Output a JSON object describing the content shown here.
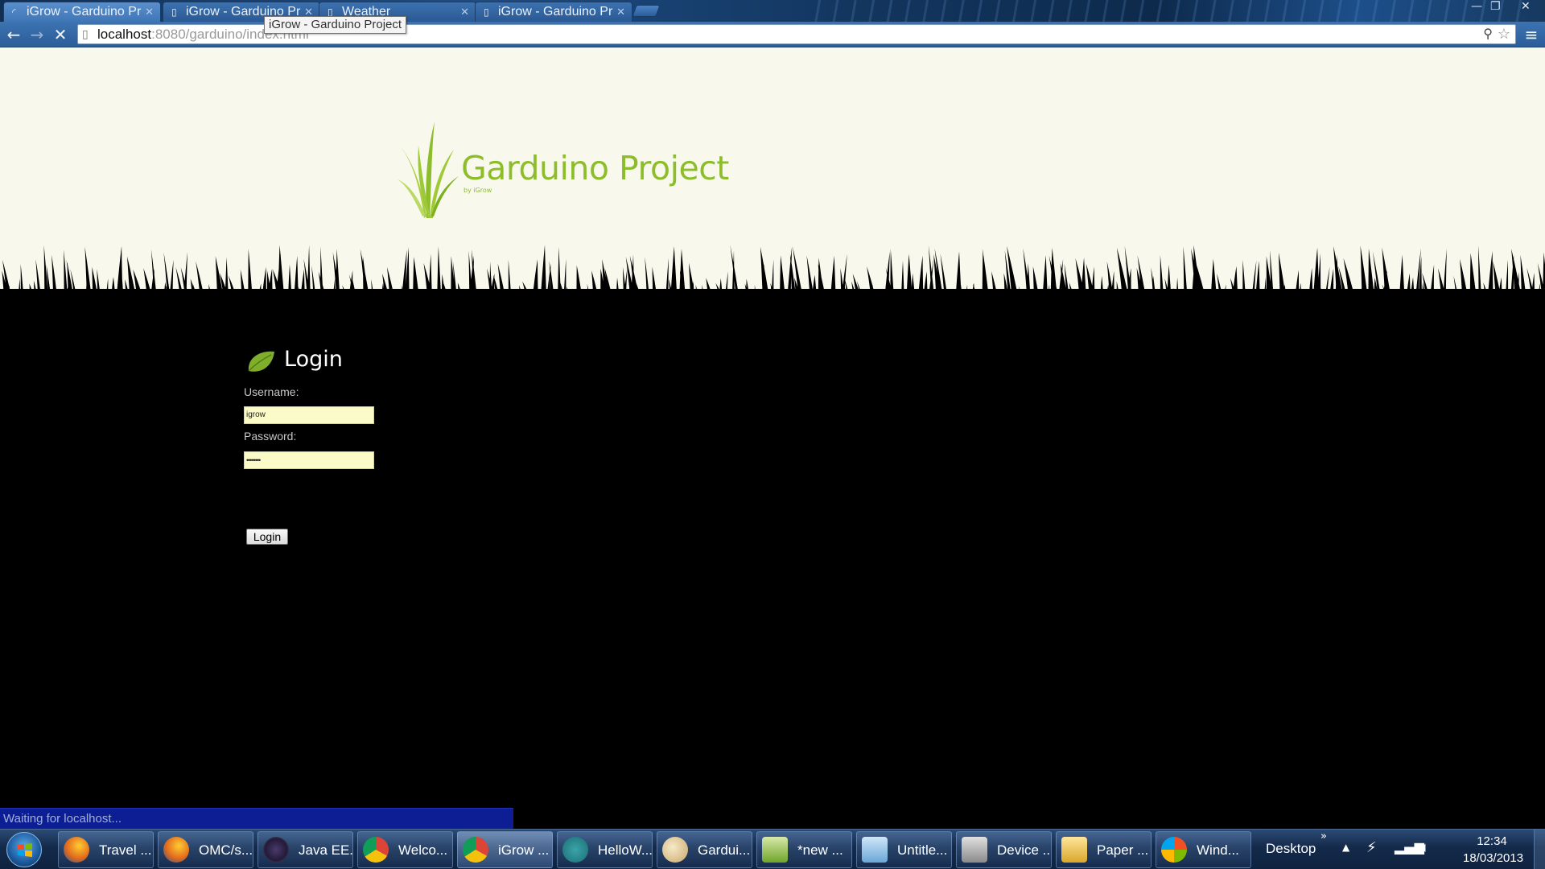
{
  "browser": {
    "tabs": [
      {
        "title": "iGrow - Garduino Pr",
        "loading": true
      },
      {
        "title": "iGrow - Garduino Pr",
        "loading": false
      },
      {
        "title": "Weather",
        "loading": false
      },
      {
        "title": "iGrow - Garduino Pr",
        "loading": false
      }
    ],
    "tooltip": "iGrow - Garduino Project",
    "url_host": "localhost",
    "url_rest": ":8080/garduino/index.html",
    "status": "Waiting for localhost..."
  },
  "page": {
    "logo_title": "Garduino Project",
    "logo_subtitle": "by iGrow",
    "login_title": "Login",
    "username_label": "Username:",
    "username_value": "igrow",
    "password_label": "Password:",
    "password_value": "••••••••",
    "login_button": "Login"
  },
  "taskbar": {
    "items": [
      {
        "label": "Travel ...",
        "icon": "firefox-icon"
      },
      {
        "label": "OMC/s...",
        "icon": "firefox-icon"
      },
      {
        "label": "Java EE...",
        "icon": "eclipse-icon"
      },
      {
        "label": "Welco...",
        "icon": "chrome-icon"
      },
      {
        "label": "iGrow ...",
        "icon": "chrome-icon",
        "active": true
      },
      {
        "label": "HelloW...",
        "icon": "arduino-icon"
      },
      {
        "label": "Gardui...",
        "icon": "paint-icon"
      },
      {
        "label": "*new ...",
        "icon": "notepad-plus-icon"
      },
      {
        "label": "Untitle...",
        "icon": "notepad-icon"
      },
      {
        "label": "Device ...",
        "icon": "device-manager-icon"
      },
      {
        "label": "Paper ...",
        "icon": "folder-icon"
      },
      {
        "label": "Wind...",
        "icon": "windows-icon"
      }
    ],
    "desktop_label": "Desktop",
    "time": "12:34",
    "date": "18/03/2013"
  }
}
